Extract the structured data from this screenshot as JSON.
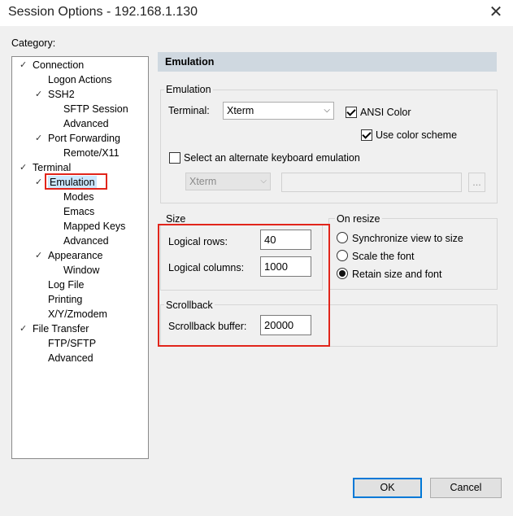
{
  "window": {
    "title": "Session Options - 192.168.1.130",
    "close_glyph": "✕"
  },
  "category_label": "Category:",
  "tree": [
    {
      "label": "Connection"
    },
    {
      "label": "Logon Actions"
    },
    {
      "label": "SSH2"
    },
    {
      "label": "SFTP Session"
    },
    {
      "label": "Advanced"
    },
    {
      "label": "Port Forwarding"
    },
    {
      "label": "Remote/X11"
    },
    {
      "label": "Terminal"
    },
    {
      "label": "Emulation",
      "selected": true
    },
    {
      "label": "Modes"
    },
    {
      "label": "Emacs"
    },
    {
      "label": "Mapped Keys"
    },
    {
      "label": "Advanced"
    },
    {
      "label": "Appearance"
    },
    {
      "label": "Window"
    },
    {
      "label": "Log File"
    },
    {
      "label": "Printing"
    },
    {
      "label": "X/Y/Zmodem"
    },
    {
      "label": "File Transfer"
    },
    {
      "label": "FTP/SFTP"
    },
    {
      "label": "Advanced"
    }
  ],
  "panel": {
    "header": "Emulation"
  },
  "emulation_group": {
    "title": "Emulation",
    "terminal_label": "Terminal:",
    "terminal_value": "Xterm",
    "ansi_color_label": "ANSI Color",
    "ansi_color_checked": true,
    "use_color_scheme_label": "Use color scheme",
    "use_color_scheme_checked": true,
    "alt_keyboard_label": "Select an alternate keyboard emulation",
    "alt_keyboard_checked": false,
    "alt_keyboard_value": "Xterm",
    "alt_keyboard_path": "",
    "browse_label": "..."
  },
  "size_group": {
    "title": "Size",
    "logical_rows_label": "Logical rows:",
    "logical_rows_value": "40",
    "logical_columns_label": "Logical columns:",
    "logical_columns_value": "1000"
  },
  "on_resize_group": {
    "title": "On resize",
    "options": [
      {
        "label": "Synchronize view to size",
        "checked": false
      },
      {
        "label": "Scale the font",
        "checked": false
      },
      {
        "label": "Retain size and font",
        "checked": true
      }
    ]
  },
  "scrollback_group": {
    "title": "Scrollback",
    "buffer_label": "Scrollback buffer:",
    "buffer_value": "20000"
  },
  "buttons": {
    "ok": "OK",
    "cancel": "Cancel"
  },
  "colors": {
    "highlight_box": "#e1251b",
    "header_bg": "#cfd8e0",
    "default_button_border": "#0078d7"
  }
}
